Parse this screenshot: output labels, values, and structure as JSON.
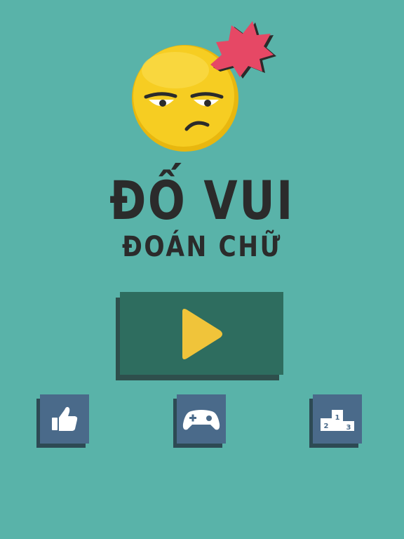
{
  "title": {
    "main": "ĐỐ VUI",
    "sub": "ĐOÁN CHỮ"
  },
  "buttons": {
    "play": {
      "icon": "play-icon"
    },
    "like": {
      "icon": "thumbs-up-icon"
    },
    "games": {
      "icon": "gamepad-icon"
    },
    "leaderboard": {
      "icon": "podium-icon",
      "ranks": [
        "2",
        "1",
        "3"
      ]
    }
  },
  "colors": {
    "background": "#59b3a9",
    "play_button": "#2e6d5f",
    "play_arrow": "#f0c43a",
    "icon_button": "#4a6a8a",
    "mascot_face": "#f6cd22",
    "burst": "#e64865"
  }
}
